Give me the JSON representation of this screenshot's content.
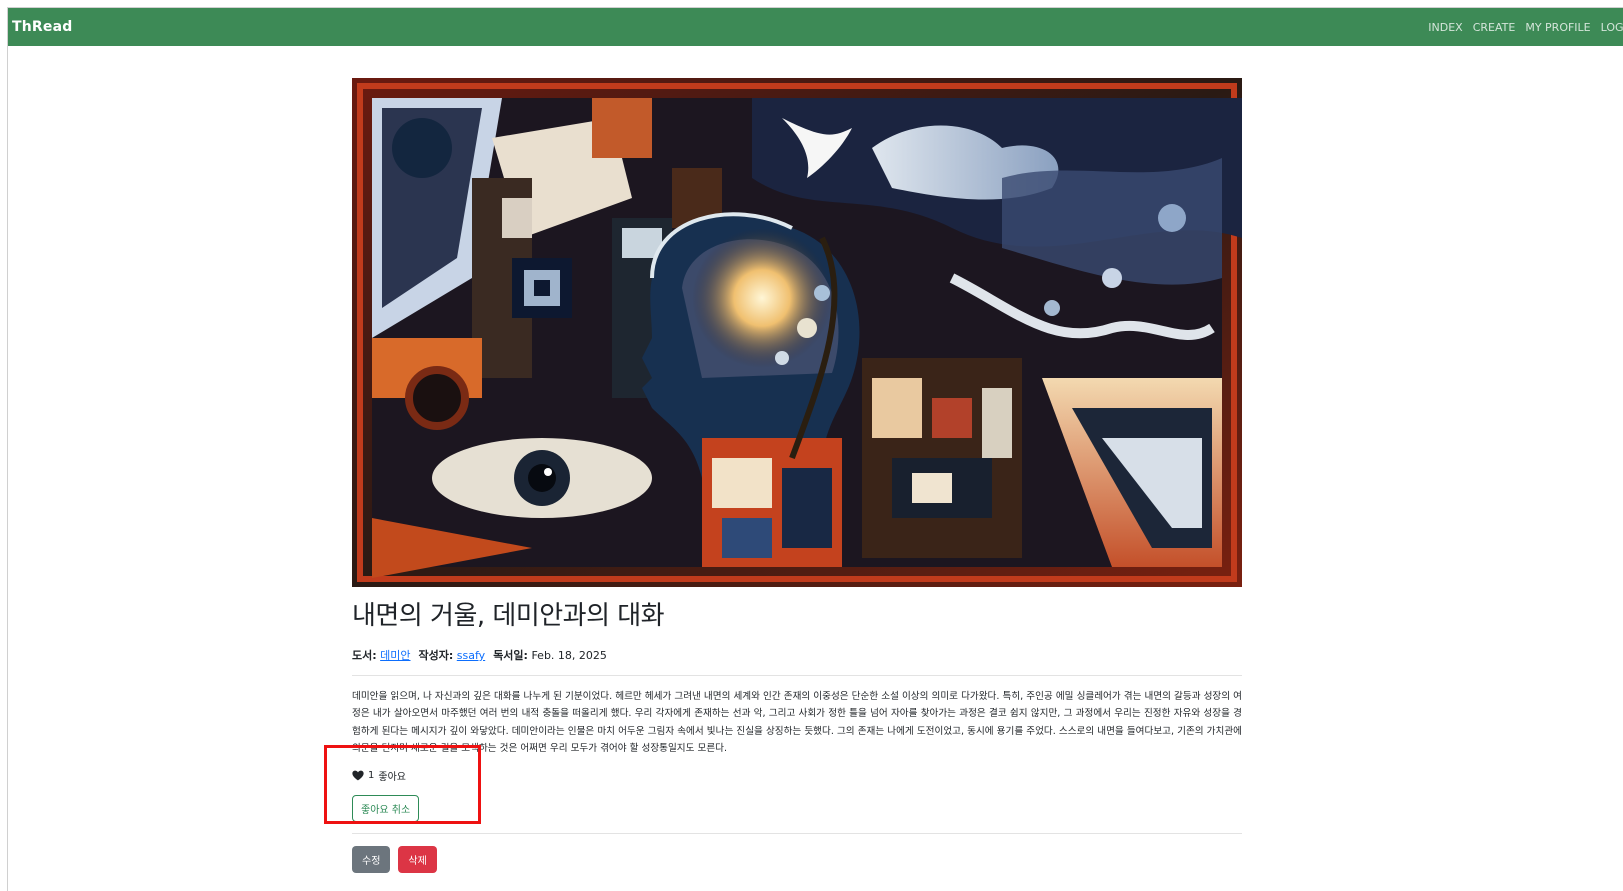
{
  "navbar": {
    "brand": "ThRead",
    "links": [
      "INDEX",
      "CREATE",
      "MY PROFILE",
      "LOGOUT"
    ],
    "color": "#3d8a56"
  },
  "post": {
    "title": "내면의 거울, 데미안과의 대화",
    "meta": {
      "book_label": "도서:",
      "book_value": "데미안",
      "author_label": "작성자:",
      "author_value": "ssafy",
      "date_label": "독서일:",
      "date_value": "Feb. 18, 2025"
    },
    "body": "데미안을 읽으며, 나 자신과의 깊은 대화를 나누게 된 기분이었다. 헤르만 헤세가 그려낸 내면의 세계와 인간 존재의 이중성은 단순한 소설 이상의 의미로 다가왔다. 특히, 주인공 에밀 싱클레어가 겪는 내면의 갈등과 성장의 여정은 내가 살아오면서 마주했던 여러 번의 내적 충돌을 떠올리게 했다. 우리 각자에게 존재하는 선과 악, 그리고 사회가 정한 틀을 넘어 자아를 찾아가는 과정은 결코 쉽지 않지만, 그 과정에서 우리는 진정한 자유와 성장을 경험하게 된다는 메시지가 깊이 와닿았다. 데미안이라는 인물은 마치 어두운 그림자 속에서 빛나는 진실을 상징하는 듯했다. 그의 존재는 나에게 도전이었고, 동시에 용기를 주었다. 스스로의 내면을 들여다보고, 기존의 가치관에 의문을 던지며 새로운 길을 모색하는 것은 어쩌면 우리 모두가 겪어야 할 성장통일지도 모른다.",
    "likes": {
      "count": "1",
      "label": "좋아요"
    },
    "unlike_label": "좋아요 취소",
    "edit_label": "수정",
    "delete_label": "삭제"
  },
  "colors": {
    "highlight": "#ee1111",
    "unlike_border": "#2e8b57",
    "edit_btn": "#6c757d",
    "delete_btn": "#dc3545",
    "link": "#0d6efd"
  }
}
